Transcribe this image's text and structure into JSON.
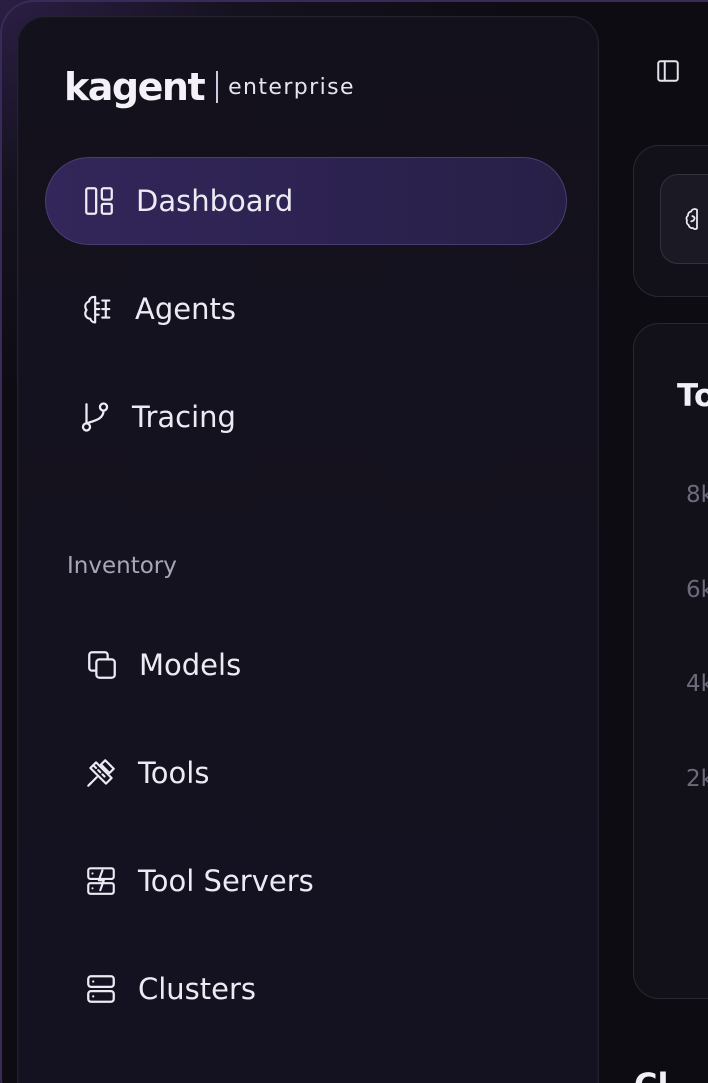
{
  "brand": {
    "logo": "kagent",
    "subtitle": "enterprise"
  },
  "sidebar": {
    "items": [
      {
        "label": "Dashboard",
        "icon": "dashboard-icon",
        "active": true
      },
      {
        "label": "Agents",
        "icon": "brain-icon"
      },
      {
        "label": "Tracing",
        "icon": "git-branch-icon"
      }
    ],
    "section_label": "Inventory",
    "inventory_items": [
      {
        "label": "Models",
        "icon": "copy-icon"
      },
      {
        "label": "Tools",
        "icon": "tools-icon"
      },
      {
        "label": "Tool Servers",
        "icon": "server-bolt-icon"
      },
      {
        "label": "Clusters",
        "icon": "server-icon"
      }
    ]
  },
  "main": {
    "chart_title_partial": "To",
    "y_ticks": [
      "8k",
      "6k",
      "4k",
      "2k"
    ],
    "bottom_heading_partial": "Cl"
  },
  "colors": {
    "accent": "#33265a",
    "background": "#0d0c13",
    "text": "#ecebf3",
    "muted": "#a9a5b8"
  }
}
